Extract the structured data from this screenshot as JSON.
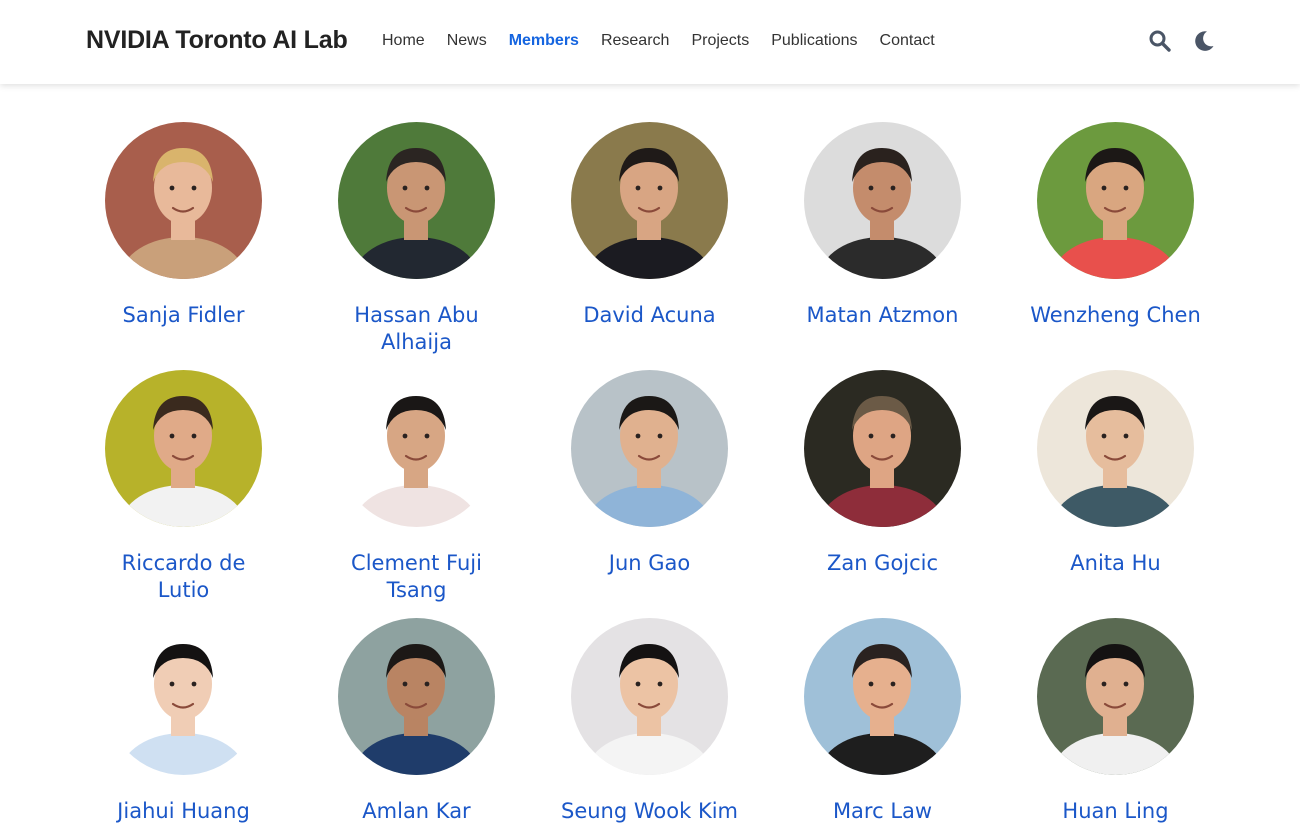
{
  "site": {
    "title": "NVIDIA Toronto AI Lab"
  },
  "nav": {
    "links": [
      "Home",
      "News",
      "Members",
      "Research",
      "Projects",
      "Publications",
      "Contact"
    ],
    "active": "Members"
  },
  "icons": {
    "search": "search-icon",
    "theme": "moon-icon"
  },
  "colors": {
    "accent": "#1565e0",
    "member_name": "#1b57c8",
    "text": "#222222"
  },
  "members": [
    {
      "name": "Sanja Fidler",
      "skin": "#e8b99a",
      "hair": "#d9b46c",
      "shirt": "#c9a07a",
      "bg": "#a85e4c"
    },
    {
      "name": "Hassan Abu Alhaija",
      "skin": "#c99674",
      "hair": "#2b2522",
      "shirt": "#222831",
      "bg": "#4f7a3a"
    },
    {
      "name": "David Acuna",
      "skin": "#d8a583",
      "hair": "#1f1a18",
      "shirt": "#1b1b21",
      "bg": "#8a7a4c"
    },
    {
      "name": "Matan Atzmon",
      "skin": "#c48c6c",
      "hair": "#2a221e",
      "shirt": "#2b2b2b",
      "bg": "#dcdcdc"
    },
    {
      "name": "Wenzheng Chen",
      "skin": "#d9a680",
      "hair": "#1c1816",
      "shirt": "#e8504c",
      "bg": "#6c9a3e"
    },
    {
      "name": "Riccardo de Lutio",
      "skin": "#e0aa88",
      "hair": "#3a2a1e",
      "shirt": "#f2f2f2",
      "bg": "#b7b22a"
    },
    {
      "name": "Clement Fuji Tsang",
      "skin": "#d7a684",
      "hair": "#1a1716",
      "shirt": "#efe3e2",
      "bg": "#ffffff"
    },
    {
      "name": "Jun Gao",
      "skin": "#e0b18f",
      "hair": "#1b1816",
      "shirt": "#8fb4d8",
      "bg": "#b8c2c8"
    },
    {
      "name": "Zan Gojcic",
      "skin": "#dea584",
      "hair": "#6b5a46",
      "shirt": "#8e2d3a",
      "bg": "#2b2a22"
    },
    {
      "name": "Anita Hu",
      "skin": "#e6bd9d",
      "hair": "#1a1716",
      "shirt": "#3e5a66",
      "bg": "#ede6da"
    },
    {
      "name": "Jiahui Huang",
      "skin": "#f0cdb5",
      "hair": "#141212",
      "shirt": "#cfe0f2",
      "bg": "#ffffff"
    },
    {
      "name": "Amlan Kar",
      "skin": "#b98463",
      "hair": "#1c1816",
      "shirt": "#1f3c6a",
      "bg": "#8ea2a0"
    },
    {
      "name": "Seung Wook Kim",
      "skin": "#ecc3a4",
      "hair": "#141212",
      "shirt": "#f4f4f4",
      "bg": "#e4e2e4"
    },
    {
      "name": "Marc Law",
      "skin": "#e6b08e",
      "hair": "#2a2220",
      "shirt": "#1e1e1e",
      "bg": "#9fc0d8"
    },
    {
      "name": "Huan Ling",
      "skin": "#e0b090",
      "hair": "#141212",
      "shirt": "#f0f0f0",
      "bg": "#5a6a52"
    }
  ]
}
